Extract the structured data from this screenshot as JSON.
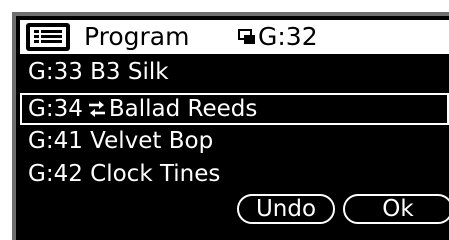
{
  "header": {
    "menu_icon": "list-menu-icon",
    "title": "Program",
    "copy_icon": "copy-icon",
    "current_id": "G:32"
  },
  "list": {
    "items": [
      {
        "id": "G:33",
        "name": "B3 Silk",
        "icon": ""
      },
      {
        "id": "G:34",
        "name": "Ballad Reeds",
        "icon": "swap-arrows-icon"
      },
      {
        "id": "G:41",
        "name": "Velvet Bop",
        "icon": ""
      },
      {
        "id": "G:42",
        "name": "Clock Tines",
        "icon": ""
      }
    ],
    "selected_index": 1
  },
  "buttons": {
    "undo_label": "Undo",
    "ok_label": "Ok"
  },
  "colors": {
    "screen_background": "#000000",
    "text": "#ffffff",
    "header_background": "#ffffff",
    "bezel": "#6f6f6f"
  }
}
